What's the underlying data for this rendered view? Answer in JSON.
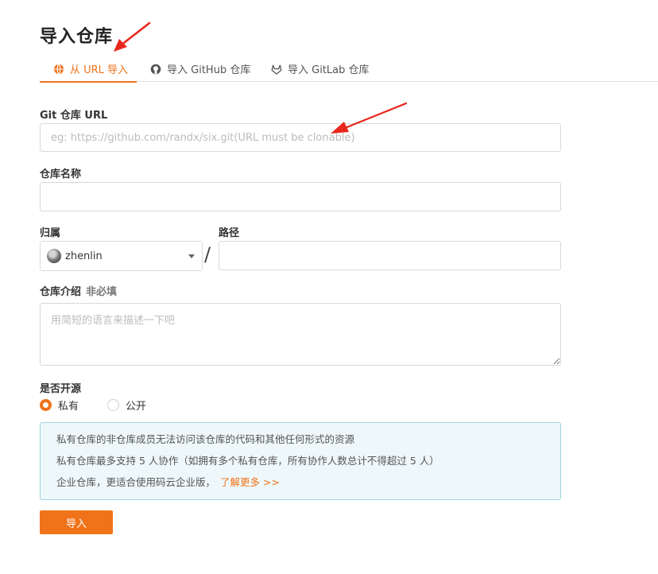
{
  "page": {
    "title": "导入仓库"
  },
  "tabs": [
    {
      "label": "从 URL 导入",
      "icon": "globe-icon",
      "active": true
    },
    {
      "label": "导入 GitHub 仓库",
      "icon": "github-icon",
      "active": false
    },
    {
      "label": "导入 GitLab 仓库",
      "icon": "gitlab-icon",
      "active": false
    }
  ],
  "form": {
    "git_url": {
      "label": "Git 仓库 URL",
      "placeholder": "eg: https://github.com/randx/six.git(URL must be clonable)",
      "value": ""
    },
    "repo_name": {
      "label": "仓库名称",
      "value": ""
    },
    "owner": {
      "label": "归属",
      "value": "zhenlin"
    },
    "separator": "/",
    "path": {
      "label": "路径",
      "value": ""
    },
    "description": {
      "label": "仓库介绍",
      "optional": "非必填",
      "placeholder": "用简短的语言来描述一下吧"
    },
    "open_source": {
      "label": "是否开源",
      "options": [
        "私有",
        "公开"
      ],
      "selected": "私有"
    }
  },
  "info": {
    "line1": "私有仓库的非仓库成员无法访问该仓库的代码和其他任何形式的资源",
    "line2": "私有仓库最多支持 5 人协作（如拥有多个私有仓库，所有协作人数总计不得超过 5 人）",
    "line3": "企业仓库，更适合使用码云企业版，",
    "link": "了解更多 >>"
  },
  "submit_label": "导入",
  "colors": {
    "accent": "#f0731a",
    "annotation_arrow": "#e8261c",
    "info_border": "#9fd3df",
    "info_bg": "#eef8fa"
  }
}
